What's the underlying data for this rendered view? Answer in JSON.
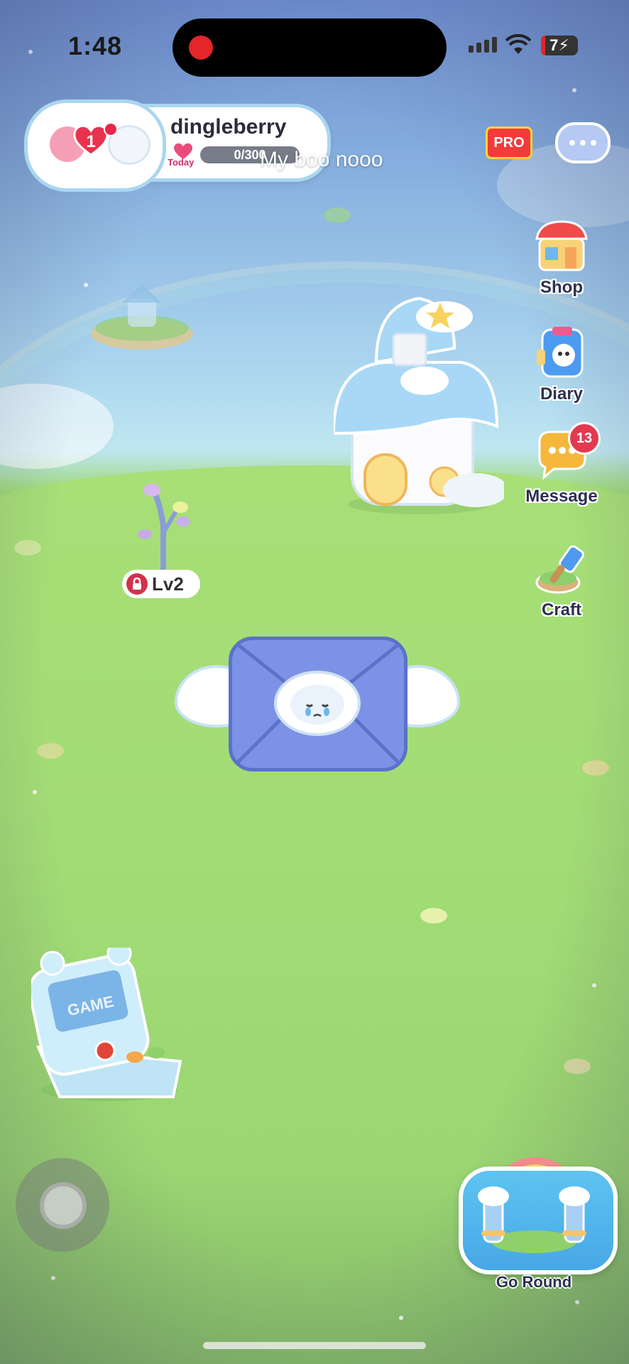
{
  "status_bar": {
    "time": "1:48",
    "battery": "7"
  },
  "profile": {
    "username": "dingleberry",
    "heart_level": "1",
    "today_label": "Today",
    "progress_text": "0/300",
    "progress_fraction": 0
  },
  "caption": "My boo nooo",
  "top_right": {
    "pro_label": "PRO"
  },
  "side_menu": [
    {
      "label": "Shop"
    },
    {
      "label": "Diary"
    },
    {
      "label": "Message",
      "badge": "13"
    },
    {
      "label": "Craft"
    }
  ],
  "tree": {
    "level_label": "Lv2"
  },
  "game_console": {
    "screen_text": "GAME"
  },
  "go_round": {
    "label": "Go Round"
  },
  "colors": {
    "grass": "#a5de77",
    "sky": "#86aede",
    "envelope": "#7c92e6",
    "badge_red": "#e23a4f",
    "card_border": "#aad6f0"
  }
}
